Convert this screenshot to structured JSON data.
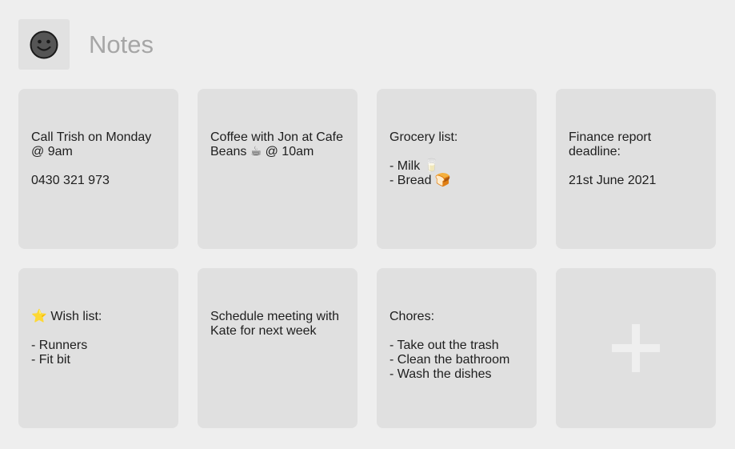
{
  "app": {
    "title": "Notes",
    "logo_icon": "smiley-face-icon"
  },
  "notes": [
    {
      "text": "Call Trish on Monday @ 9am\n\n0430 321 973"
    },
    {
      "text": "Coffee with Jon at Cafe Beans ☕ @ 10am"
    },
    {
      "text": "Grocery list:\n\n- Milk 🥛\n- Bread 🍞"
    },
    {
      "text": "Finance report deadline:\n\n21st June 2021"
    },
    {
      "text": "⭐ Wish list:\n\n- Runners\n- Fit bit"
    },
    {
      "text": "Schedule meeting with Kate for next week"
    },
    {
      "text": "Chores:\n\n- Take out the trash\n- Clean the bathroom\n- Wash the dishes"
    }
  ],
  "add_note": {
    "icon": "plus-icon"
  },
  "colors": {
    "background": "#eeeeee",
    "card": "#e0e0e0",
    "title": "#a6a6a6",
    "text": "#1e1e1e"
  }
}
